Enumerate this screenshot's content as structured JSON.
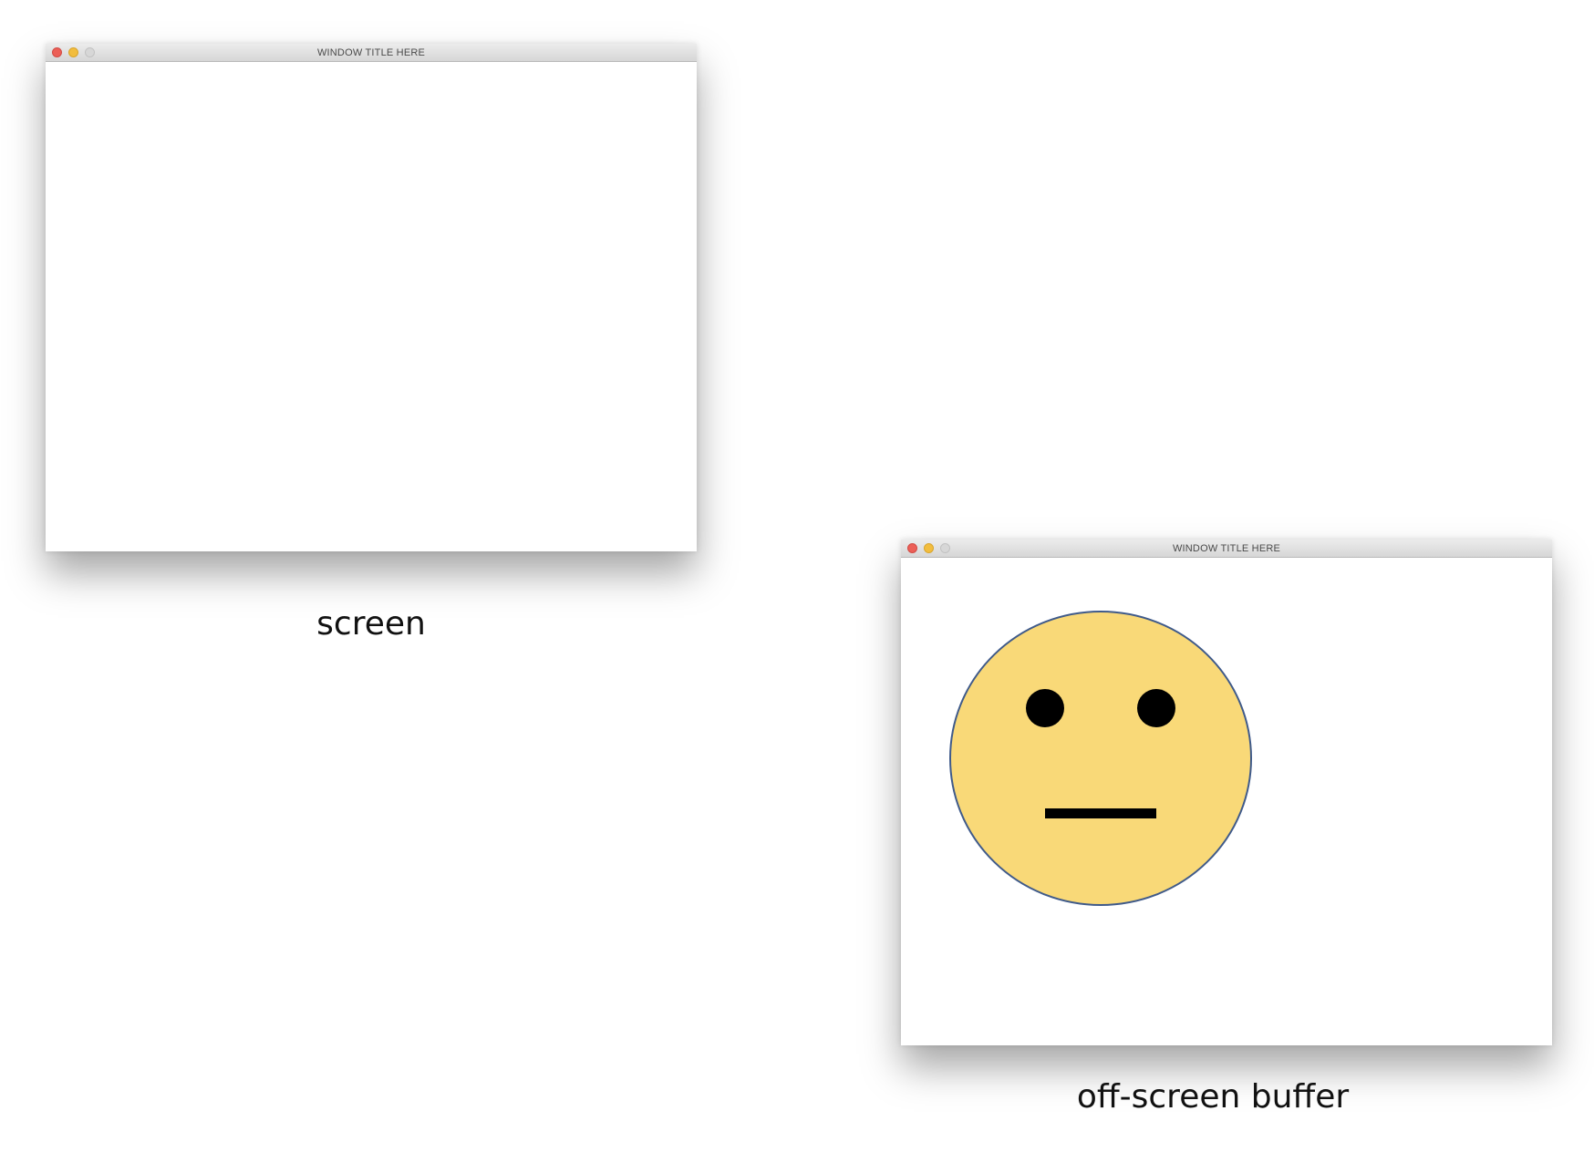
{
  "windows": {
    "screen": {
      "title": "WINDOW TITLE HERE",
      "caption": "screen"
    },
    "buffer": {
      "title": "WINDOW TITLE HERE",
      "caption": "off-screen buffer"
    }
  },
  "icons": {
    "close": "close-icon",
    "minimize": "minimize-icon",
    "maximize": "maximize-icon",
    "face": "neutral-face-icon"
  },
  "colors": {
    "close": "#ec5f57",
    "minimize": "#f2bd3e",
    "maximize": "#d7d7d7",
    "face_fill": "#f9d978",
    "face_stroke": "#3f5a8a",
    "features": "#000000"
  }
}
